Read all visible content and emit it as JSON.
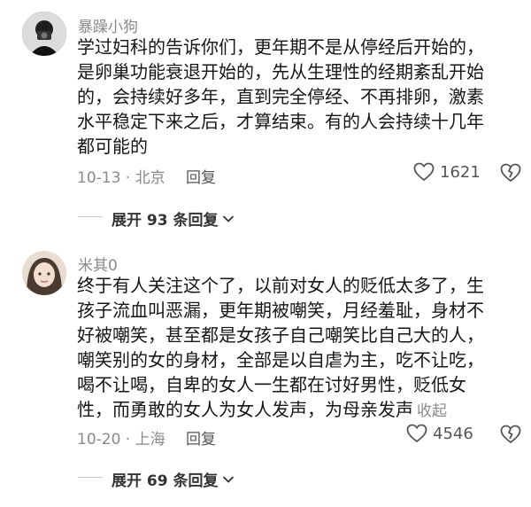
{
  "comments": [
    {
      "username": "暴躁小狗",
      "lines": [
        "学过妇科的告诉你们，更年期不是从停经后开始的，",
        "是卵巢功能衰退开始的，先从生理性的经期紊乱开始",
        "的，会持续好多年，直到完全停经、不再排卵，激素",
        "水平稳定下来之后，才算结束。有的人会持续十几年",
        "都可能的"
      ],
      "collapse_label": "",
      "date_location": "10-13 · 北京",
      "reply_label": "回复",
      "like_count": "1621",
      "expand_label": "展开 93 条回复"
    },
    {
      "username": "米其0",
      "lines": [
        "终于有人关注这个了，以前对女人的贬低太多了，生",
        "孩子流血叫恶漏，更年期被嘲笑，月经羞耻，身材不",
        "好被嘲笑，甚至都是女孩子自己嘲笑比自己大的人，",
        "嘲笑别的女的身材，全部是以自虐为主，吃不让吃，",
        "喝不让喝，自卑的女人一生都在讨好男性，贬低女",
        "性，而勇敢的女人为女人发声，为母亲发声"
      ],
      "collapse_label": "收起",
      "date_location": "10-20 · 上海",
      "reply_label": "回复",
      "like_count": "4546",
      "expand_label": "展开 69 条回复"
    }
  ],
  "icons": {
    "like": "heart-outline-icon",
    "dislike": "broken-heart-icon",
    "expand": "chevron-down-icon"
  },
  "colors": {
    "text": "#161616",
    "muted": "#8a8a8a",
    "background": "#ffffff"
  }
}
